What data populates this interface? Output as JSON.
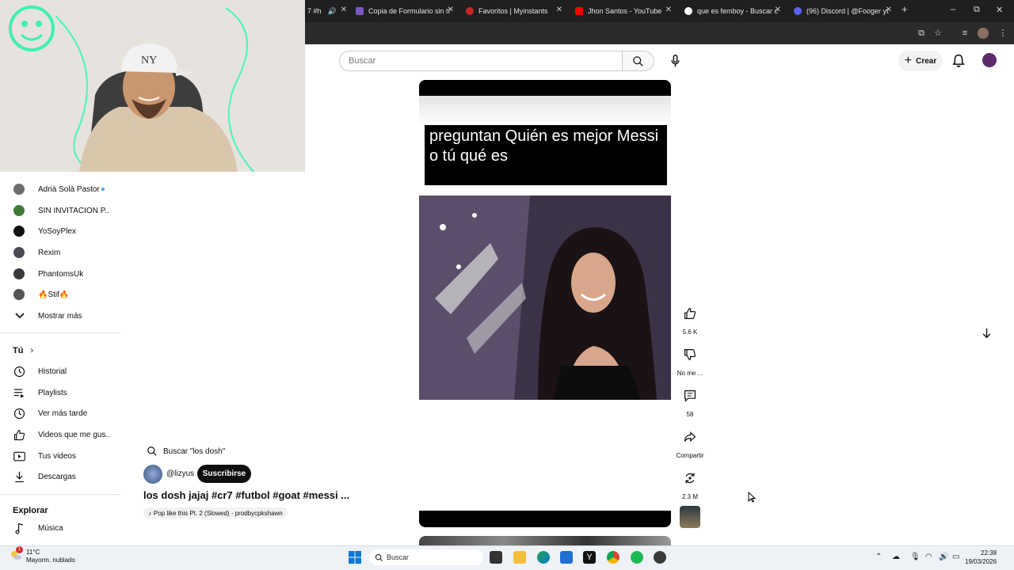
{
  "browser": {
    "tabs": [
      {
        "label": "7 #h",
        "favicon_color": "#ff0000"
      },
      {
        "label": "Copia de Formulario sin tí",
        "favicon_color": "#7e57c2"
      },
      {
        "label": "Favoritos | Myinstants",
        "favicon_color": "#c62828"
      },
      {
        "label": "Jhon Santos - YouTube",
        "favicon_color": "#ff0000"
      },
      {
        "label": "que es femboy - Buscar c",
        "favicon_color": "#ffffff"
      },
      {
        "label": "(96) Discord | @Fooger yt",
        "favicon_color": "#5865f2"
      }
    ],
    "new_tab": "+",
    "window_controls": {
      "minimize": "–",
      "maximize": "⧉",
      "close": "✕"
    }
  },
  "youtube": {
    "search_placeholder": "Buscar",
    "create_label": "Crear"
  },
  "sidebar": {
    "subscriptions": [
      {
        "name": "Adrià Solà Pastor",
        "avatar_color": "#6b6b6b",
        "has_dot": true
      },
      {
        "name": "SIN INVITACIÓN P...",
        "avatar_color": "#3f7a3a",
        "has_dot": false
      },
      {
        "name": "YoSoyPlex",
        "avatar_color": "#111111",
        "has_dot": false
      },
      {
        "name": "Rexim",
        "avatar_color": "#4a4a55",
        "has_dot": false
      },
      {
        "name": "PhantomsUk",
        "avatar_color": "#3a3a3a",
        "has_dot": false
      },
      {
        "name": "🔥Stif🔥",
        "avatar_color": "#555555",
        "has_dot": false
      }
    ],
    "show_more": "Mostrar más",
    "you_section": "Tú",
    "you_items": [
      "Historial",
      "Playlists",
      "Ver más tarde",
      "Videos que me gus...",
      "Tus videos",
      "Descargas"
    ],
    "explore_section": "Explorar",
    "explore_items": [
      "Música"
    ]
  },
  "short": {
    "caption": "preguntan Quién es mejor Messi o tú qué es",
    "actions": {
      "like_count": "5.6 K",
      "dislike_label": "No me ...",
      "comments_count": "58",
      "share_label": "Compartir",
      "remix_count": "2.3 M"
    },
    "search_chip": "Buscar \"los dosh\"",
    "channel": "@lizyus",
    "subscribe_label": "Suscribirse",
    "title": "los dosh jajaj #cr7 #futbol #goat #messi ...",
    "music": "Pop like this Pt. 2 (Slowed) · prodbycpkshawn"
  },
  "taskbar": {
    "weather_temp": "11°C",
    "weather_desc": "Mayorm. nublado",
    "weather_badge": "1",
    "search_label": "Buscar",
    "time": "22:38",
    "date": "19/03/2026"
  }
}
